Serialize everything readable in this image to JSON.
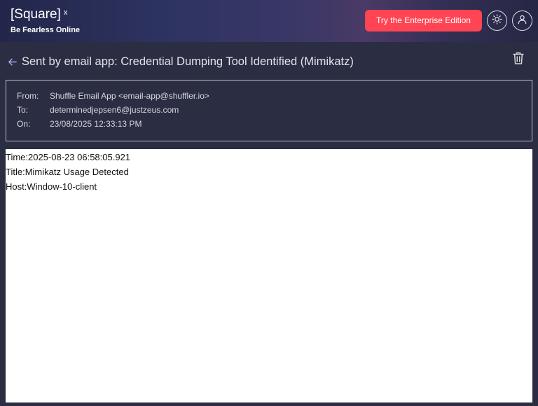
{
  "header": {
    "brand_title": "[Square]",
    "brand_sup": "x",
    "brand_subtitle": "Be Fearless Online",
    "enterprise_button": "Try the Enterprise Edition",
    "theme_icon": "sun-icon",
    "user_icon": "user-icon",
    "accent_color": "#ff4554"
  },
  "message": {
    "subject": "Sent by email app: Credential Dumping Tool Identified (Mimikatz)",
    "back_icon": "arrow-left-icon",
    "delete_icon": "trash-icon",
    "from_label": "From:",
    "from_value": "Shuffle Email App <email-app@shuffler.io>",
    "to_label": "To:",
    "to_value": "determinedjepsen6@justzeus.com",
    "on_label": "On:",
    "on_value": "23/08/2025 12:33:13 PM",
    "body_lines": [
      "Time:2025-08-23 06:58:05.921",
      "Title:Mimikatz Usage Detected",
      "Host:Window-10-client"
    ]
  }
}
